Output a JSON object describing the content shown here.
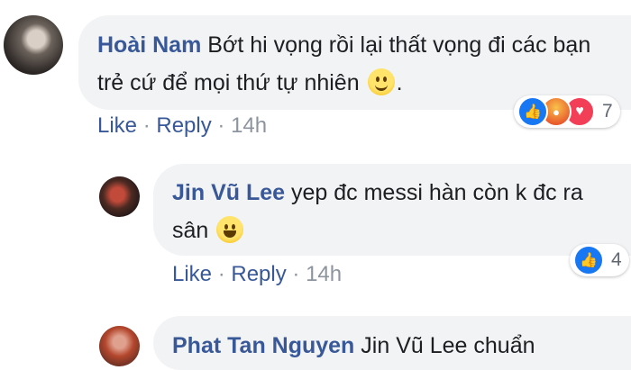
{
  "comments": [
    {
      "author": "Hoài Nam",
      "text": "Bớt hi vọng rồi lại thất vọng đi các bạn trẻ cứ để mọi thứ tự nhiên",
      "text_after_emoji": ".",
      "emoji": "slightly-smiling-face",
      "actions": {
        "like": "Like",
        "reply": "Reply",
        "sep": "·",
        "time": "14h"
      },
      "reactions": {
        "icons": [
          "like",
          "angry",
          "love"
        ],
        "count": "7"
      }
    },
    {
      "author": "Jin Vũ Lee",
      "text": "yep đc messi hàn còn k đc ra sân",
      "emoji": "grinning-face",
      "actions": {
        "like": "Like",
        "reply": "Reply",
        "sep": "·",
        "time": "14h"
      },
      "reactions": {
        "icons": [
          "like"
        ],
        "count": "4"
      }
    },
    {
      "author": "Phat Tan Nguyen",
      "text": "Jin Vũ Lee chuẩn"
    }
  ],
  "colors": {
    "author": "#385898",
    "bubble": "#f2f3f5",
    "like": "#1877f2"
  }
}
